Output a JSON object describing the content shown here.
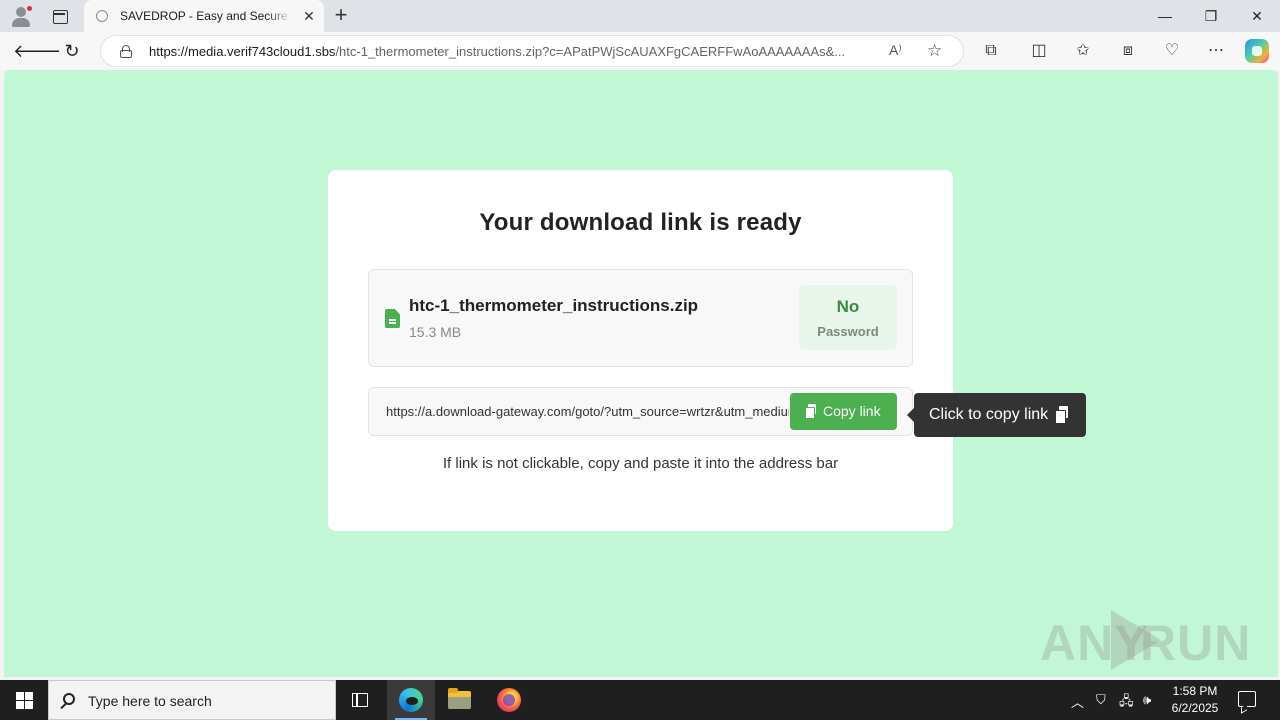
{
  "browser": {
    "tab": {
      "title": "SAVEDROP - Easy and Secure File Sharing",
      "close_glyph": "✕"
    },
    "new_tab_glyph": "+",
    "window_controls": {
      "minimize": "—",
      "restore": "❐",
      "close": "✕"
    },
    "address_bar": {
      "host": "https://media.verif743cloud1.sbs",
      "path": "/htc-1_thermometer_instructions.zip?c=APatPWjScAUAXFgCAERFFwAoAAAAAAAs&..."
    },
    "icons": {
      "back": "back-arrow-icon",
      "refresh": "refresh-icon",
      "lock": "lock-icon",
      "read_aloud": "read-aloud-icon",
      "favorite": "star-icon",
      "extensions": "puzzle-icon",
      "split": "split-screen-icon",
      "favorites": "favorites-icon",
      "collections": "collections-icon",
      "performance": "heart-pulse-icon",
      "more": "ellipsis-icon",
      "copilot": "copilot-icon"
    }
  },
  "page": {
    "heading": "Your download link is ready",
    "file": {
      "name": "htc-1_thermometer_instructions.zip",
      "size": "15.3 MB",
      "password_top": "No",
      "password_bottom": "Password"
    },
    "link": {
      "url": "https://a.download-gateway.com/goto/?utm_source=wrtzr&utm_medium=savedrop",
      "copy_label": "Copy link"
    },
    "hint": "If link is not clickable, copy and paste it into the address bar",
    "tooltip": "Click to copy link",
    "watermark_left": "ANY",
    "watermark_right": "RUN"
  },
  "colors": {
    "page_background": "#c2f7d5",
    "accent_green": "#4caf50",
    "badge_background": "#e8f5ea",
    "tooltip_background": "#333333"
  },
  "taskbar": {
    "search_placeholder": "Type here to search",
    "time": "1:58 PM",
    "date": "6/2/2025"
  }
}
